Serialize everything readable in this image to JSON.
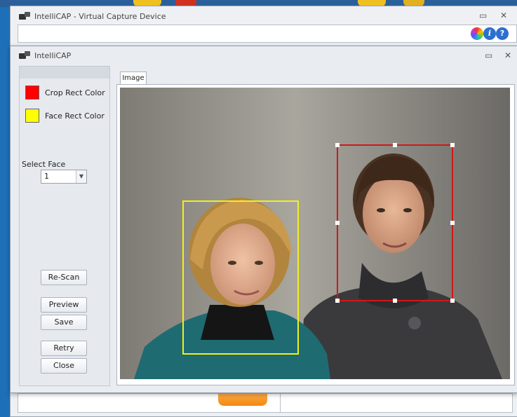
{
  "back_window": {
    "title": "IntelliCAP - Virtual Capture Device"
  },
  "front_window": {
    "title": "IntelliCAP"
  },
  "window_controls": {
    "minimize": "▭",
    "close": "✕"
  },
  "toolbar_icons": [
    "color-wheel-icon",
    "info-icon",
    "help-icon"
  ],
  "toolbar_glyphs": {
    "info": "i",
    "help": "?"
  },
  "left_panel": {
    "crop_rect_color": {
      "label": "Crop Rect Color",
      "color": "#ff0000"
    },
    "face_rect_color": {
      "label": "Face Rect Color",
      "color": "#ffff00"
    },
    "select_face": {
      "label": "Select Face",
      "value": "1"
    },
    "buttons": {
      "rescan": "Re-Scan",
      "preview": "Preview",
      "save": "Save",
      "retry": "Retry",
      "close": "Close"
    }
  },
  "image_tab": {
    "label": "Image"
  },
  "colors": {
    "crop_rect": "#d01818",
    "face_rect": "#f0f020",
    "accent_orange": "#f08a10"
  }
}
